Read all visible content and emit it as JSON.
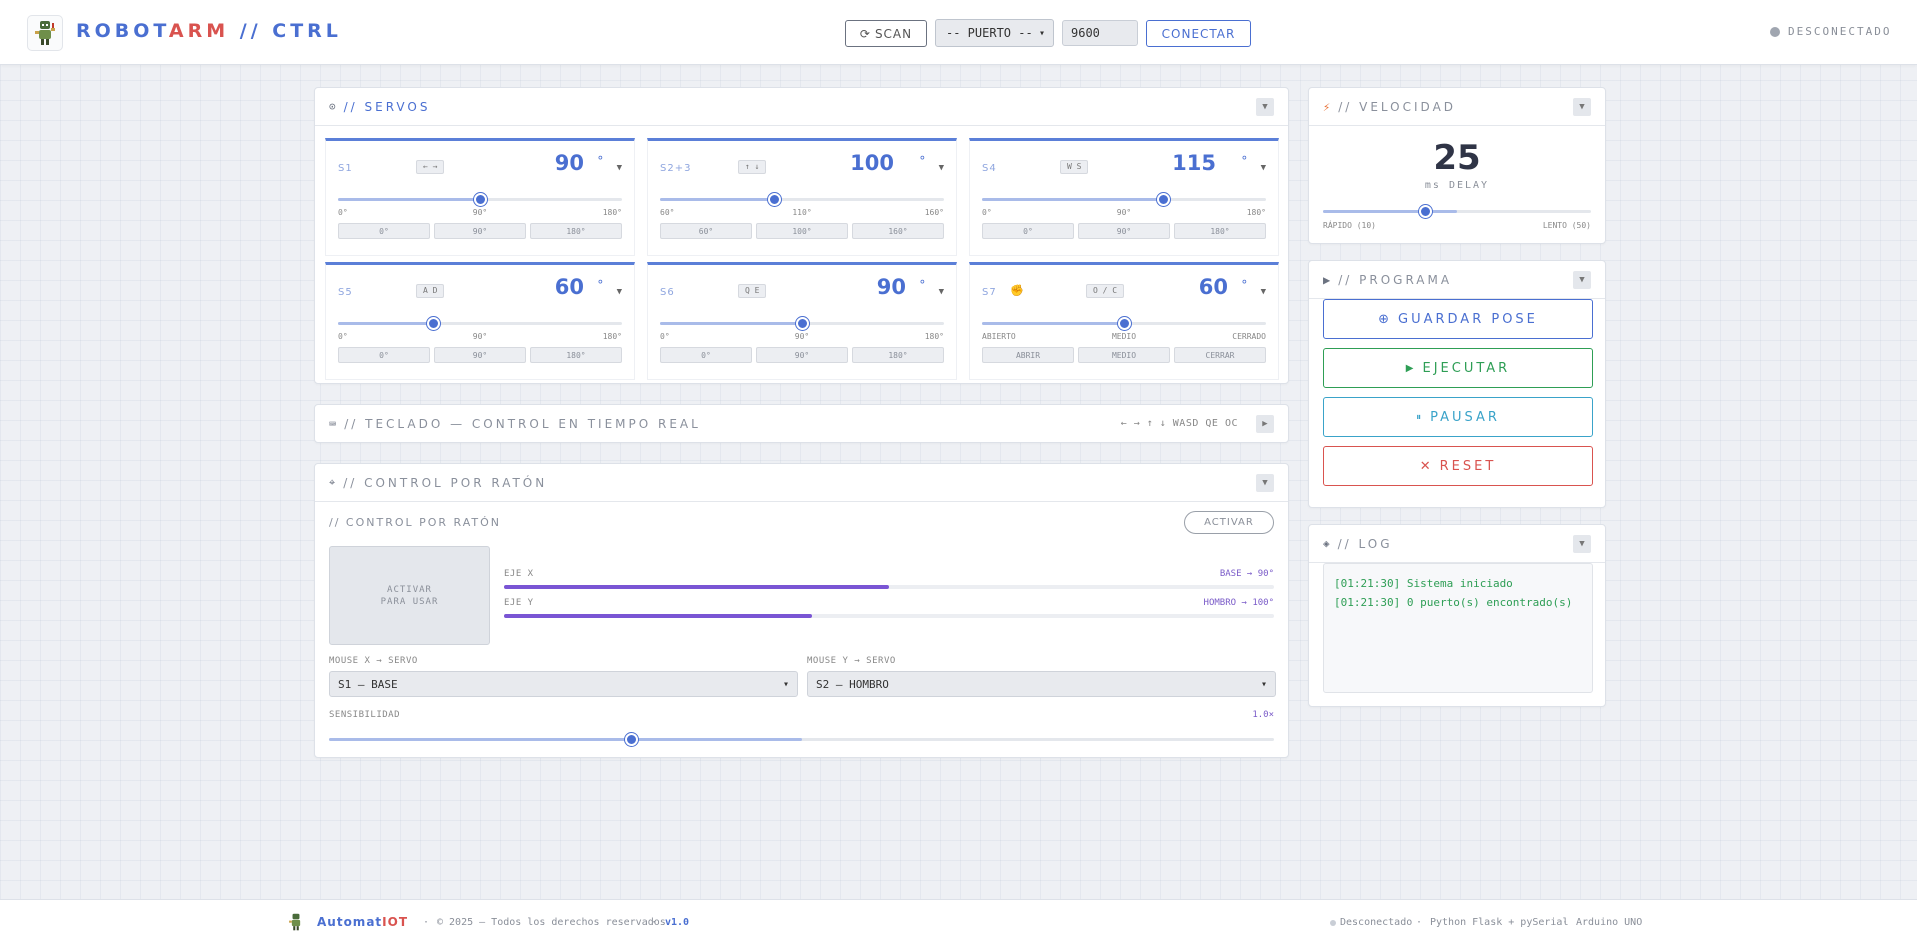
{
  "header": {
    "brand_part1": "ROBOT",
    "brand_accent": "ARM",
    "brand_part2": " // CTRL",
    "scan_label": "SCAN",
    "port_placeholder": "-- PUERTO --",
    "baud_value": "9600",
    "connect_label": "CONECTAR",
    "status": "DESCONECTADO"
  },
  "servos_panel": {
    "title": "// SERVOS",
    "servos": [
      {
        "name": "S1",
        "keys": "← →",
        "value": "90",
        "unit": "°",
        "min": 0,
        "max": 180,
        "current": 90,
        "ticks": [
          "0°",
          "90°",
          "180°"
        ],
        "presets": [
          "0°",
          "90°",
          "180°"
        ]
      },
      {
        "name": "S2+3",
        "keys": "↑ ↓",
        "value": "100",
        "unit": "°",
        "min": 60,
        "max": 160,
        "current": 100,
        "ticks": [
          "60°",
          "110°",
          "160°"
        ],
        "presets": [
          "60°",
          "100°",
          "160°"
        ]
      },
      {
        "name": "S4",
        "keys": "W S",
        "value": "115",
        "unit": "°",
        "min": 0,
        "max": 180,
        "current": 115,
        "ticks": [
          "0°",
          "90°",
          "180°"
        ],
        "presets": [
          "0°",
          "90°",
          "180°"
        ]
      },
      {
        "name": "S5",
        "keys": "A D",
        "value": "60",
        "unit": "°",
        "min": 0,
        "max": 180,
        "current": 60,
        "ticks": [
          "0°",
          "90°",
          "180°"
        ],
        "presets": [
          "0°",
          "90°",
          "180°"
        ]
      },
      {
        "name": "S6",
        "keys": "Q E",
        "value": "90",
        "unit": "°",
        "min": 0,
        "max": 180,
        "current": 90,
        "ticks": [
          "0°",
          "90°",
          "180°"
        ],
        "presets": [
          "0°",
          "90°",
          "180°"
        ]
      },
      {
        "name": "S7",
        "keys": "O / C",
        "value": "60",
        "unit": "°",
        "min": 0,
        "max": 120,
        "current": 60,
        "ticks": [
          "ABIERTO",
          "MEDIO",
          "CERRADO"
        ],
        "presets": [
          "ABRIR",
          "MEDIO",
          "CERRAR"
        ]
      }
    ]
  },
  "keyboard_panel": {
    "title": "// TECLADO — CONTROL EN TIEMPO REAL",
    "hint": "← → ↑ ↓ WASD QE OC"
  },
  "mouse_panel": {
    "title": "// CONTROL POR RATÓN",
    "subtitle": "// CONTROL POR RATÓN",
    "activate_label": "ACTIVAR",
    "pad_text": "ACTIVAR\nPARA USAR",
    "axis_x_label": "EJE X",
    "axis_x_value": "BASE → 90°",
    "axis_x_fraction": 0.5,
    "axis_y_label": "EJE Y",
    "axis_y_value": "HOMBRO → 100°",
    "axis_y_fraction": 0.4,
    "mouse_x_label": "MOUSE X → SERVO",
    "mouse_x_value": "S1 — BASE",
    "mouse_y_label": "MOUSE Y → SERVO",
    "mouse_y_value": "S2 — HOMBRO",
    "sens_label": "SENSIBILIDAD",
    "sens_value": "1.0×",
    "sens_fraction": 0.32
  },
  "speed_panel": {
    "title": "// VELOCIDAD",
    "value": "25",
    "unit": "ms DELAY",
    "min_label": "RÁPIDO (10)",
    "max_label": "LENTO (50)",
    "fraction": 0.38
  },
  "program_panel": {
    "title": "// PROGRAMA",
    "save_label": "GUARDAR POSE",
    "run_label": "EJECUTAR",
    "pause_label": "PAUSAR",
    "reset_label": "RESET"
  },
  "log_panel": {
    "title": "// LOG",
    "lines": [
      "[01:21:30] Sistema iniciado",
      "[01:21:30] 0 puerto(s) encontrado(s)"
    ]
  },
  "footer": {
    "brand": "Automat",
    "brand_accent": "IOT",
    "copyright": "© 2025 — Todos los derechos reservados",
    "version": "v1.0",
    "status": "Desconectado",
    "stack": "Python Flask + pySerial",
    "board": "Arduino UNO"
  },
  "colors": {
    "accent": "#4a6fd1",
    "danger": "#d9534f",
    "success": "#2e9e55",
    "purple": "#7a55d4",
    "info": "#3aa3c9"
  }
}
